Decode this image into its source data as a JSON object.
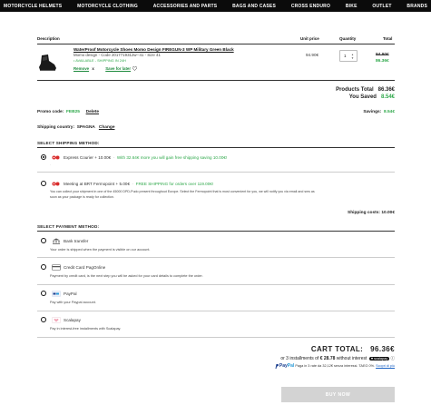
{
  "nav": {
    "items": [
      "MOTORCYCLE HELMETS",
      "MOTORCYCLE CLOTHING",
      "ACCESSORIES AND PARTS",
      "BAGS AND CASES",
      "CROSS ENDURO",
      "BIKE",
      "OUTLET",
      "BRANDS"
    ]
  },
  "table": {
    "col_description": "Description",
    "col_unit_price": "Unit price",
    "col_quantity": "Quantity",
    "col_total": "Total"
  },
  "product": {
    "name": "WaterProof Motorcycle Shoes Momo Design FIREGUN-3 WP Military Green Black",
    "meta": "Momo design - Code 2017719312w--41 - Size 41",
    "availability": "• AVAILABLE - SHIPPING IN 24H",
    "remove_label": "Remove",
    "remove_icon": "x",
    "save_label": "Save for later",
    "save_icon": "heart-outline",
    "unit_price": "94.90€",
    "quantity": "1",
    "total_old": "94.90€",
    "total_new": "86.36€"
  },
  "summary": {
    "products_total_label": "Products Total",
    "products_total_value": "86.36€",
    "you_saved_label": "You Saved",
    "you_saved_value": "8.54€"
  },
  "promo": {
    "label": "Promo code:",
    "code": "FEB25",
    "delete_label": "Delete",
    "savings_label": "Savings:",
    "savings_value": "8.54€"
  },
  "shipping_country": {
    "label": "Shipping country:",
    "value": "SPAGNA",
    "change_label": "Change"
  },
  "shipping": {
    "title": "SELECT SHIPPING METHOD:",
    "options": [
      {
        "name": "Express Courier",
        "price": "10.00€",
        "note": "With 32.64€ more you will gain free shipping saving 10.00€!",
        "selected": true
      },
      {
        "name": "Meeting at BRT Fermopoint",
        "price": "5.00€",
        "note": "FREE SHIPPING for orders over 119.00€!",
        "desc1": "You can collect your shipment in one of the 45000 DPD-Pudo present throughout Europe. Select the Fermopoint that is most convenient for you, we will notify you via email and sms as",
        "desc2": "soon as your package is ready for collection.",
        "selected": false
      }
    ],
    "costs_label": "Shipping costs:",
    "costs_value": "10.00€"
  },
  "payment": {
    "title": "SELECT PAYMENT METHOD:",
    "options": [
      {
        "name": "Bank transfer",
        "desc": "Your order is shipped when the payment is visible on our account.",
        "icon": "bank-icon"
      },
      {
        "name": "Credit Card PagOnline",
        "desc": "Payment by credit card, is the next step you will be asked for your card details to complete the order.",
        "icon": "credit-card-icon"
      },
      {
        "name": "PayPal",
        "desc": "Pay with your Paypal account.",
        "icon": "paypal-icon"
      },
      {
        "name": "Scalapay",
        "desc": "Pay in interest-free installments with Scalapay.",
        "icon": "scalapay-icon"
      }
    ]
  },
  "cart": {
    "total_label": "CART TOTAL:",
    "total_value": "96.36€",
    "installments_prefix": "or 3 installments of",
    "installments_amount": "€ 28.78",
    "installments_suffix": "without interest",
    "scalapay_badge": "♥ scalapay",
    "info_icon": "ⓘ",
    "paypal_word_1": "Pay",
    "paypal_word_2": "Pal",
    "paypal_text": "Paga in 3 rate da 32,12€ senza interessi. TAEG 0%.",
    "paypal_link": "Scopri di più",
    "buy_label": "BUY NOW"
  },
  "colors": {
    "accent_green": "#2ea84a",
    "nav_bg": "#0b0b0b",
    "buy_disabled": "#d3d3d3"
  }
}
